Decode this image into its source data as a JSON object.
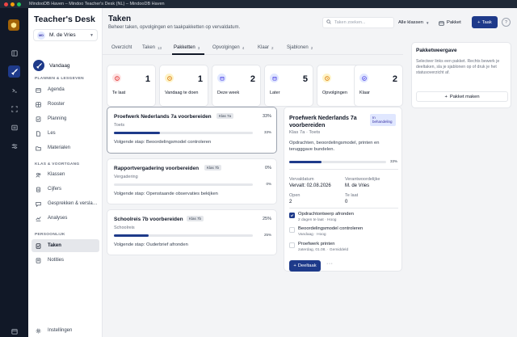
{
  "window": {
    "title": "MindooDB Haven – Mindoo Teacher's Desk (NL) – MindooDB Haven"
  },
  "sidebar": {
    "brand": "Teacher's Desk",
    "user": {
      "initials": "MD",
      "name": "M. de Vries"
    },
    "today_label": "Vandaag",
    "sections": {
      "plannen": "PLANNEN & LESGEVEN",
      "klas": "KLAS & VOORTGANG",
      "persoonlijk": "PERSOONLIJK"
    },
    "items": [
      {
        "label": "Agenda",
        "icon": "calendar-icon"
      },
      {
        "label": "Rooster",
        "icon": "grid-icon"
      },
      {
        "label": "Planning",
        "icon": "checklist-icon"
      },
      {
        "label": "Les",
        "icon": "document-icon"
      },
      {
        "label": "Materialen",
        "icon": "folder-icon"
      },
      {
        "label": "Klassen",
        "icon": "users-icon"
      },
      {
        "label": "Cijfers",
        "icon": "clipboard-icon"
      },
      {
        "label": "Gesprekken & versla…",
        "icon": "chat-icon"
      },
      {
        "label": "Analyses",
        "icon": "chart-icon"
      },
      {
        "label": "Taken",
        "icon": "tasks-icon"
      },
      {
        "label": "Notities",
        "icon": "note-icon"
      }
    ],
    "active_item": "Taken",
    "settings_label": "Instellingen"
  },
  "header": {
    "title": "Taken",
    "subtitle": "Beheer taken, opvolgingen en taakpakketten op vervaldatum.",
    "search_placeholder": "Taken zoeken...",
    "class_filter": "Alle klassen",
    "pakket_button": "Pakket",
    "taak_button": "Taak",
    "help": "?"
  },
  "tabs": [
    {
      "label": "Overzicht",
      "count": ""
    },
    {
      "label": "Taken",
      "count": "13"
    },
    {
      "label": "Pakketten",
      "count": "3"
    },
    {
      "label": "Opvolgingen",
      "count": "4"
    },
    {
      "label": "Klaar",
      "count": "2"
    },
    {
      "label": "Sjablonen",
      "count": "2"
    }
  ],
  "active_tab": "Pakketten",
  "stats": [
    {
      "label": "Te laat",
      "value": "1",
      "icon": "alert-circle-icon",
      "color": "#dc2626"
    },
    {
      "label": "Vandaag te doen",
      "value": "1",
      "icon": "clock-icon",
      "color": "#d97706"
    },
    {
      "label": "Deze week",
      "value": "2",
      "icon": "calendar-icon",
      "color": "#4f46e5"
    },
    {
      "label": "Later",
      "value": "5",
      "icon": "calendar-icon",
      "color": "#4f46e5"
    },
    {
      "label": "Opvolgingen",
      "value": "4",
      "icon": "clock-icon",
      "color": "#d97706"
    },
    {
      "label": "Klaar",
      "value": "2",
      "icon": "check-circle-icon",
      "color": "#4f46e5"
    }
  ],
  "packages": [
    {
      "title": "Proefwerk Nederlands 7a voorbereiden",
      "class": "Klas 7a",
      "category": "Toets",
      "progress": 33,
      "progress_label": "33%",
      "next_step": "Volgende stap: Beoordelingsmodel controleren"
    },
    {
      "title": "Rapportvergadering voorbereiden",
      "class": "Klas 7b",
      "category": "Vergadering",
      "progress": 0,
      "progress_label": "0%",
      "next_step": "Volgende stap: Openstaande observaties bekijken"
    },
    {
      "title": "Schoolreis 7b voorbereiden",
      "class": "Klas 7b",
      "category": "Schoolreis",
      "progress": 25,
      "progress_label": "25%",
      "next_step": "Volgende stap: Ouderbrief afronden"
    }
  ],
  "detail": {
    "title": "Proefwerk Nederlands 7a voorbereiden",
    "status": "In behandeling",
    "meta": "Klas 7a · Toets",
    "description": "Opdrachten, beoordelingsmodel, printen en terugggave bundelen.",
    "progress": 33,
    "progress_label": "33%",
    "due_label": "Vervaldatum",
    "due_value": "Vervalt: 02.08.2026",
    "owner_label": "Verantwoordelijke",
    "owner_value": "M. de Vries",
    "open_label": "Open",
    "open_value": "2",
    "late_label": "Te laat",
    "late_value": "0",
    "steps": [
      {
        "title": "Opdrachtontwerp afronden",
        "meta": "2 dagen te laat · Hoog",
        "done": true
      },
      {
        "title": "Beoordelingsmodel controleren",
        "meta": "Vandaag · Hoog",
        "done": false
      },
      {
        "title": "Proefwerk printen",
        "meta": "zaterdag, 01.08. · Gemiddeld",
        "done": false
      }
    ],
    "add_button": "Deeltaak",
    "more": "···"
  },
  "package_panel": {
    "title": "Pakketweergave",
    "description": "Selecteer links een pakket. Rechts bewerk je deeltaken, sla je sjablonen op of druk je het statusoverzicht af.",
    "button": "Pakket maken"
  },
  "colors": {
    "accent": "#1e3a8a",
    "sidebar_bg": "#111827",
    "brand_gold": "#a16207"
  }
}
